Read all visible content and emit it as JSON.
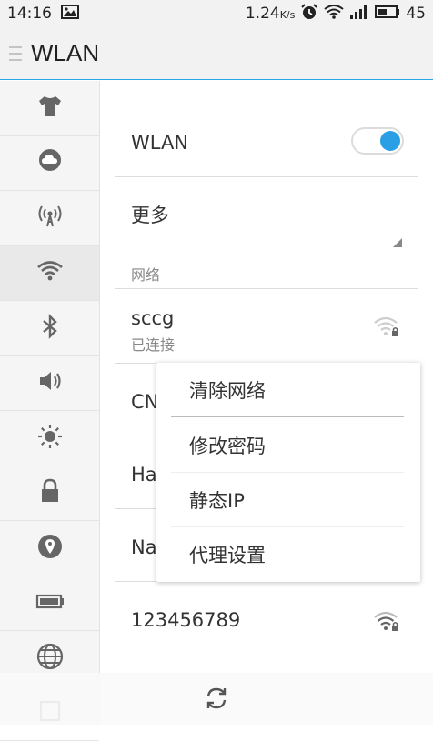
{
  "status_bar": {
    "time": "14:16",
    "speed": "1.24",
    "speed_unit": "K/s",
    "battery": "45"
  },
  "header": {
    "title": "WLAN"
  },
  "sidebar": {
    "items": [
      {
        "icon": "shirt-icon"
      },
      {
        "icon": "cloud-icon"
      },
      {
        "icon": "hotspot-icon"
      },
      {
        "icon": "wifi-icon",
        "active": true
      },
      {
        "icon": "bluetooth-icon"
      },
      {
        "icon": "speaker-icon"
      },
      {
        "icon": "brightness-icon"
      },
      {
        "icon": "lock-icon"
      },
      {
        "icon": "location-icon"
      },
      {
        "icon": "battery-icon"
      },
      {
        "icon": "globe-icon"
      },
      {
        "icon": "apps-icon"
      }
    ]
  },
  "main": {
    "wlan_label": "WLAN",
    "wlan_enabled": true,
    "more_label": "更多",
    "networks_header": "网络",
    "networks": [
      {
        "name": "sccg",
        "status": "已连接"
      },
      {
        "name": "CN"
      },
      {
        "name": "Ha"
      },
      {
        "name": "Na"
      },
      {
        "name": "123456789"
      }
    ]
  },
  "popup_menu": {
    "items": [
      "清除网络",
      "修改密码",
      "静态IP",
      "代理设置"
    ]
  },
  "bottom_bar": {
    "refresh_icon": "refresh-icon"
  },
  "colors": {
    "accent": "#2a9fe6",
    "header_bg": "#f2f2f2",
    "sidebar_bg": "#f5f5f5"
  }
}
